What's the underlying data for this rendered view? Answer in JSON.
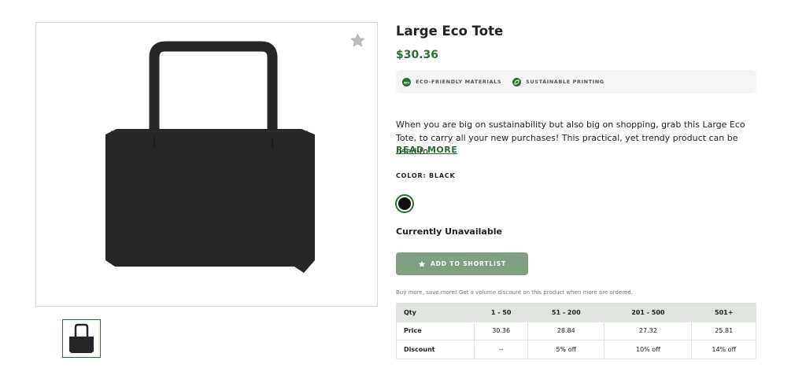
{
  "product": {
    "title": "Large Eco Tote",
    "price": "$30.36",
    "image_alt_color": "#2a2a2a"
  },
  "badges": [
    {
      "label": "ECO-FRIENDLY MATERIALS",
      "icon": "eco-icon"
    },
    {
      "label": "SUSTAINABLE PRINTING",
      "icon": "leaf-icon"
    }
  ],
  "description": {
    "text": "When you are big on sustainability but also big on shopping, grab this Large Eco Tote, to carry all your new purchases! This practical, yet trendy product can be used to...",
    "read_more": "READ MORE"
  },
  "color": {
    "label": "COLOR: BLACK",
    "swatch": "#111111"
  },
  "availability": "Currently Unavailable",
  "shortlist_button": "ADD TO SHORTLIST",
  "volume": {
    "note": "Buy more, save more! Get a volume discount on this product when more are ordered.",
    "headers": [
      "Qty",
      "1 - 50",
      "51 - 200",
      "201 - 500",
      "501+"
    ],
    "price_label": "Price",
    "prices": [
      "30.36",
      "28.84",
      "27.32",
      "25.81"
    ],
    "discount_label": "Discount",
    "discounts": [
      "--",
      "5% off",
      "10% off",
      "14% off"
    ]
  },
  "colors": {
    "brand_green": "#2f6b35",
    "button_green": "#7fa181",
    "table_header": "#dfe4df"
  }
}
